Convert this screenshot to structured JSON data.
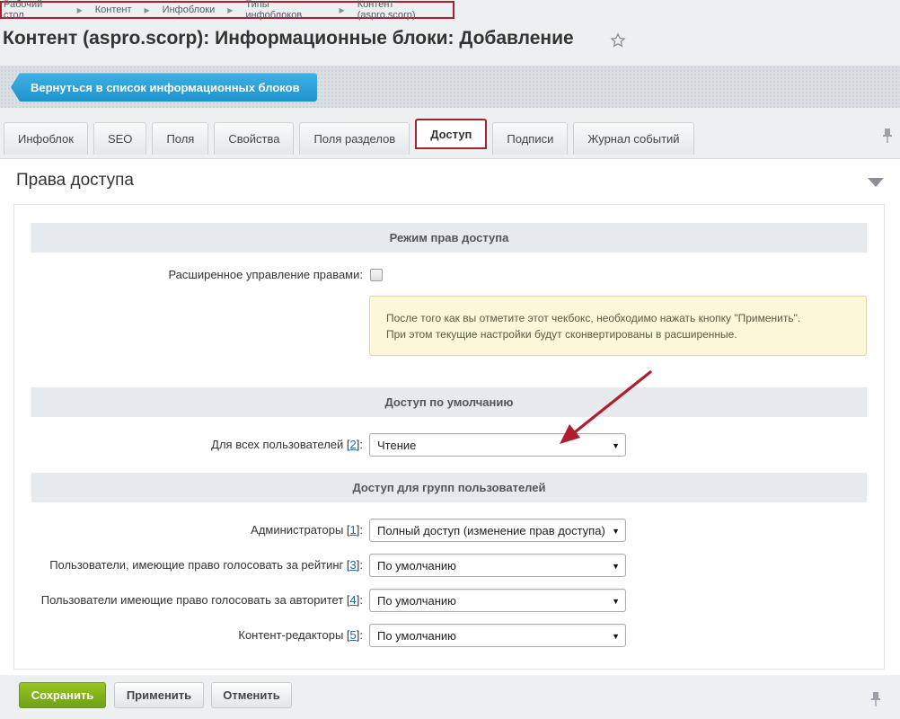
{
  "breadcrumb": [
    "Рабочий стол",
    "Контент",
    "Инфоблоки",
    "Типы инфоблоков",
    "Контент (aspro.scorp)"
  ],
  "page_title": "Контент (aspro.scorp): Информационные блоки: Добавление",
  "back_button": "Вернуться в список информационных блоков",
  "tabs": [
    "Инфоблок",
    "SEO",
    "Поля",
    "Свойства",
    "Поля разделов",
    "Доступ",
    "Подписи",
    "Журнал событий"
  ],
  "active_tab": "Доступ",
  "section_title": "Права доступа",
  "mode_header": "Режим прав доступа",
  "extended_label": "Расширенное управление правами:",
  "note_line1": "После того как вы отметите этот чекбокс, необходимо нажать кнопку \"Применить\".",
  "note_line2": "При этом текущие настройки будут сконвертированы в расширенные.",
  "default_header": "Доступ по умолчанию",
  "all_users": {
    "label": "Для всех пользователей",
    "id": "2",
    "value": "Чтение"
  },
  "groups_header": "Доступ для групп пользователей",
  "groups": [
    {
      "label": "Администраторы",
      "id": "1",
      "value": "Полный доступ (изменение прав доступа)"
    },
    {
      "label": "Пользователи, имеющие право голосовать за рейтинг",
      "id": "3",
      "value": "По умолчанию"
    },
    {
      "label": "Пользователи имеющие право голосовать за авторитет",
      "id": "4",
      "value": "По умолчанию"
    },
    {
      "label": "Контент-редакторы",
      "id": "5",
      "value": "По умолчанию"
    }
  ],
  "buttons": {
    "save": "Сохранить",
    "apply": "Применить",
    "cancel": "Отменить"
  },
  "colors": {
    "accent_blue": "#1f93cc",
    "save_green": "#7aad1a",
    "highlight_red": "#b01e2e"
  }
}
